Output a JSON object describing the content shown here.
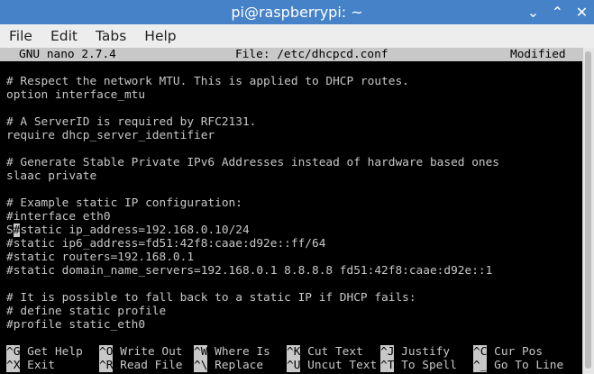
{
  "window": {
    "title": "pi@raspberrypi: ~",
    "min_glyph": "⌄",
    "max_glyph": "⌃",
    "close_glyph": "✕"
  },
  "menu": [
    "File",
    "Edit",
    "Tabs",
    "Help"
  ],
  "nano": {
    "version": "GNU nano 2.7.4",
    "file": "File: /etc/dhcpcd.conf",
    "status": "Modified"
  },
  "lines": [
    "",
    "# Respect the network MTU. This is applied to DHCP routes.",
    "option interface_mtu",
    "",
    "# A ServerID is required by RFC2131.",
    "require dhcp_server_identifier",
    "",
    "# Generate Stable Private IPv6 Addresses instead of hardware based ones",
    "slaac private",
    "",
    "# Example static IP configuration:",
    "#interface eth0",
    "",
    "#static ip6_address=fd51:42f8:caae:d92e::ff/64",
    "#static routers=192.168.0.1",
    "#static domain_name_servers=192.168.0.1 8.8.8.8 fd51:42f8:caae:d92e::1",
    "",
    "# It is possible to fall back to a static IP if DHCP fails:",
    "# define static profile",
    "#profile static_eth0"
  ],
  "cursor_line": {
    "before": "S",
    "cursor": "#",
    "after": "static ip_address=192.168.0.10/24"
  },
  "shortcuts": [
    {
      "key": "^G",
      "label": "Get Help"
    },
    {
      "key": "^O",
      "label": "Write Out"
    },
    {
      "key": "^W",
      "label": "Where Is"
    },
    {
      "key": "^K",
      "label": "Cut Text"
    },
    {
      "key": "^J",
      "label": "Justify"
    },
    {
      "key": "^C",
      "label": "Cur Pos"
    },
    {
      "key": "^X",
      "label": "Exit"
    },
    {
      "key": "^R",
      "label": "Read File"
    },
    {
      "key": "^\\",
      "label": "Replace"
    },
    {
      "key": "^U",
      "label": "Uncut Text"
    },
    {
      "key": "^T",
      "label": "To Spell"
    },
    {
      "key": "^_",
      "label": "Go To Line"
    }
  ]
}
